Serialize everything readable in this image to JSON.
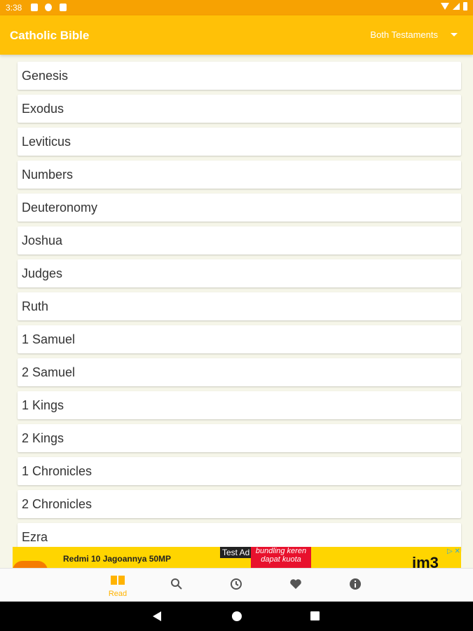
{
  "status_bar": {
    "time": "3:38"
  },
  "app_bar": {
    "title": "Catholic Bible",
    "testament_selector": "Both Testaments"
  },
  "books": [
    "Genesis",
    "Exodus",
    "Leviticus",
    "Numbers",
    "Deuteronomy",
    "Joshua",
    "Judges",
    "Ruth",
    "1 Samuel",
    "2 Samuel",
    "1 Kings",
    "2 Kings",
    "1 Chronicles",
    "2 Chronicles",
    "Ezra"
  ],
  "ad": {
    "label": "Test Ad",
    "headline": "Redmi 10 Jagoannya 50MP",
    "promo": "bundling keren dapat kuota",
    "logo": "im3",
    "adchoices": "▷ ✕"
  },
  "bottom_nav": {
    "items": [
      {
        "name": "read",
        "label": "Read",
        "icon": "book-icon"
      },
      {
        "name": "search",
        "icon": "search-icon"
      },
      {
        "name": "history",
        "icon": "history-icon"
      },
      {
        "name": "favorites",
        "icon": "heart-icon"
      },
      {
        "name": "info",
        "icon": "info-icon"
      }
    ],
    "active_color": "#ffb300"
  },
  "colors": {
    "app_bar": "#ffc107",
    "status_bar": "#f7a202",
    "background": "#f6f6e9"
  }
}
